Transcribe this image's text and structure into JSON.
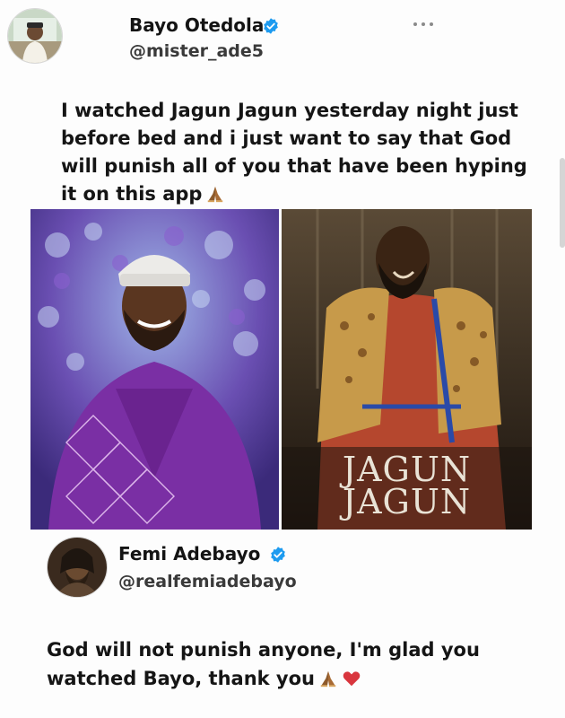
{
  "original_tweet": {
    "author_name": "Bayo Otedola",
    "handle": "@mister_ade5",
    "text": "I watched Jagun Jagun yesterday night just before bed and i just want to say that God will punish all of you that have been hyping it on this app",
    "emoji": "pray-emoji"
  },
  "media": {
    "left_photo": "person-in-purple-agbada",
    "right_photo": "movie-poster",
    "poster_title_line1": "JAGUN",
    "poster_title_line2": "JAGUN"
  },
  "reply": {
    "author_name": "Femi Adebayo",
    "handle": "@realfemiadebayo",
    "text": "God will not punish anyone, I'm glad you watched Bayo, thank you",
    "emojis": [
      "pray-emoji",
      "heart-emoji"
    ]
  },
  "colors": {
    "verified_badge": "#1d9bf0",
    "text": "#151515",
    "handle": "#3a3a3a"
  }
}
